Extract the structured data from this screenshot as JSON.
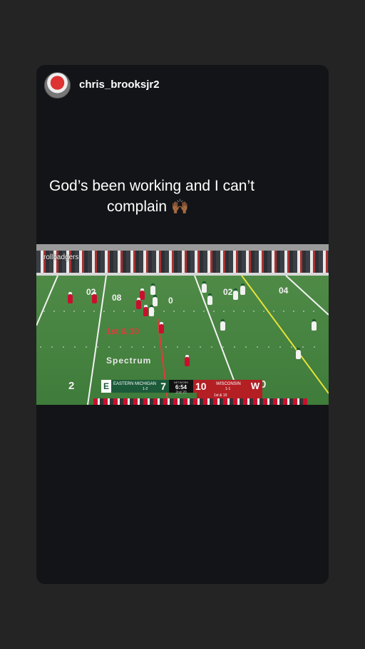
{
  "story": {
    "username": "chris_brooksjr2",
    "caption_line1": "God’s been working and I can’t",
    "caption_line2": "complain",
    "caption_emoji": "🙌🏾"
  },
  "video": {
    "watermark": "rollbadgers",
    "field_numbers": [
      "02",
      "08",
      "0",
      "02",
      "04",
      "2",
      "0"
    ],
    "first_down_marker": "1st & 10",
    "sponsor_text": "Spectrum",
    "colors": {
      "field": "#3f7b3a",
      "away_team": "#1c5a3a",
      "home_team": "#b41f24"
    },
    "scorebug": {
      "away_logo": "E",
      "away_name": "EASTERN MICHIGAN",
      "away_record": "1-2",
      "away_score": "7",
      "network": "NETWORK",
      "clock": "6:54",
      "down_clock": "2nd 20",
      "home_score": "10",
      "home_name": "WISCONSIN",
      "home_record": "1-1",
      "home_logo": "W",
      "situation": "1st & 10"
    }
  }
}
